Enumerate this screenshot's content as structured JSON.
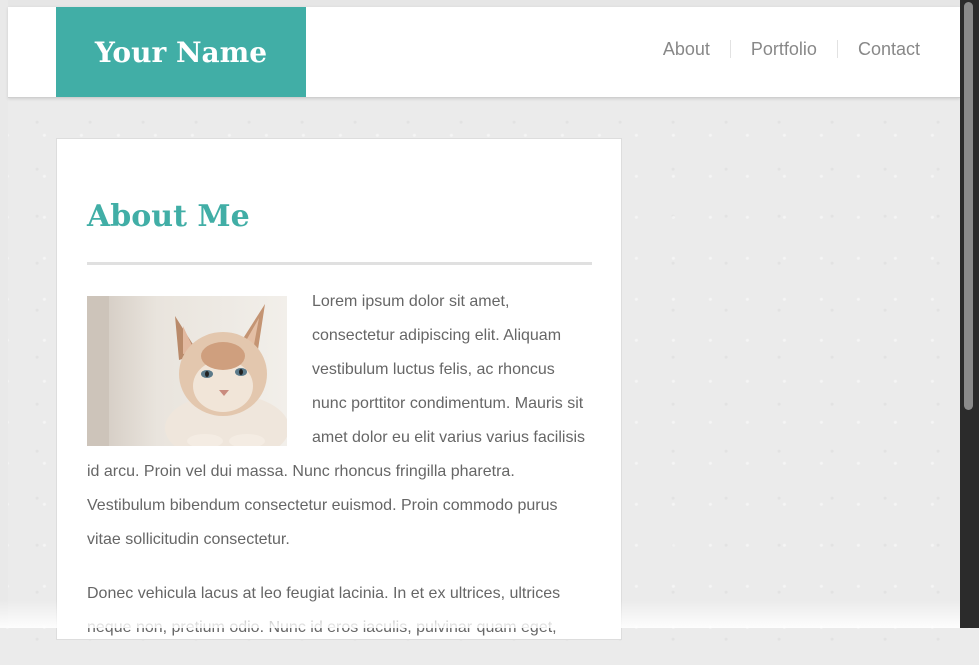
{
  "header": {
    "logo_text": "Your Name",
    "nav": [
      "About",
      "Portfolio",
      "Contact"
    ]
  },
  "main": {
    "title": "About Me",
    "paragraph1": "Lorem ipsum dolor sit amet, consectetur adipiscing elit. Aliquam vestibulum luctus felis, ac rhoncus nunc porttitor condimentum. Mauris sit amet dolor eu elit varius varius facilisis id arcu. Proin vel dui massa. Nunc rhoncus fringilla pharetra. Vestibulum bibendum consectetur euismod. Proin commodo purus vitae sollicitudin consectetur.",
    "paragraph2": "Donec vehicula lacus at leo feugiat lacinia. In et ex ultrices, ultrices neque non, pretium odio. Nunc id eros iaculis, pulvinar quam eget,"
  },
  "colors": {
    "accent": "#41aea6",
    "text": "#666666",
    "nav_text": "#888888"
  }
}
